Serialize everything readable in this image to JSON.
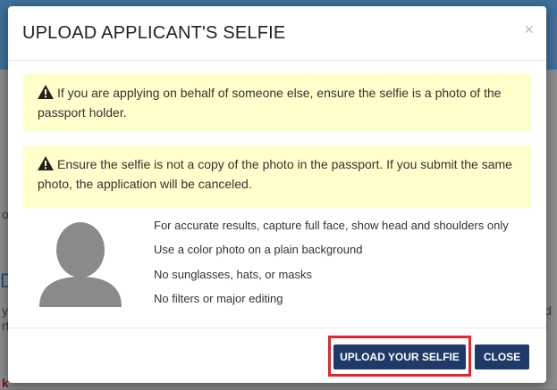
{
  "background": {
    "fragments": [
      "or",
      "D",
      "y r",
      "rty",
      "k",
      "d i"
    ]
  },
  "modal": {
    "title": "UPLOAD APPLICANT'S SELFIE",
    "close_symbol": "×",
    "alerts": [
      "If you are applying on behalf of someone else, ensure the selfie is a photo of the passport holder.",
      "Ensure the selfie is not a copy of the photo in the passport. If you submit the same photo, the application will be canceled."
    ],
    "guidelines": [
      "For accurate results, capture full face, show head and shoulders only",
      "Use a color photo on a plain background",
      "No sunglasses, hats, or masks",
      "No filters or major editing"
    ],
    "buttons": {
      "upload": "UPLOAD YOUR SELFIE",
      "close": "CLOSE"
    }
  },
  "colors": {
    "alert_bg": "#ffffcc",
    "button_bg": "#1f3a68",
    "highlight": "#e8232a"
  }
}
